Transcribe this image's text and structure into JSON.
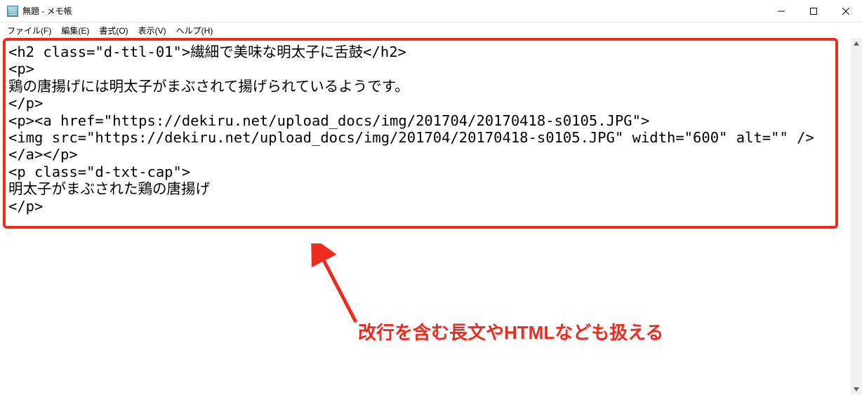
{
  "titlebar": {
    "title": "無題 - メモ帳"
  },
  "menubar": {
    "items": [
      {
        "label": "ファイル(F)"
      },
      {
        "label": "編集(E)"
      },
      {
        "label": "書式(O)"
      },
      {
        "label": "表示(V)"
      },
      {
        "label": "ヘルプ(H)"
      }
    ]
  },
  "editor": {
    "content": "<h2 class=\"d-ttl-01\">繊細で美味な明太子に舌鼓</h2>\n<p>\n鶏の唐揚げには明太子がまぶされて揚げられているようです。\n</p>\n<p><a href=\"https://dekiru.net/upload_docs/img/201704/20170418-s0105.JPG\">\n<img src=\"https://dekiru.net/upload_docs/img/201704/20170418-s0105.JPG\" width=\"600\" alt=\"\" />\n</a></p>\n<p class=\"d-txt-cap\">\n明太子がまぶされた鶏の唐揚げ\n</p>"
  },
  "annotation": {
    "text": "改行を含む長文やHTMLなども扱える"
  }
}
